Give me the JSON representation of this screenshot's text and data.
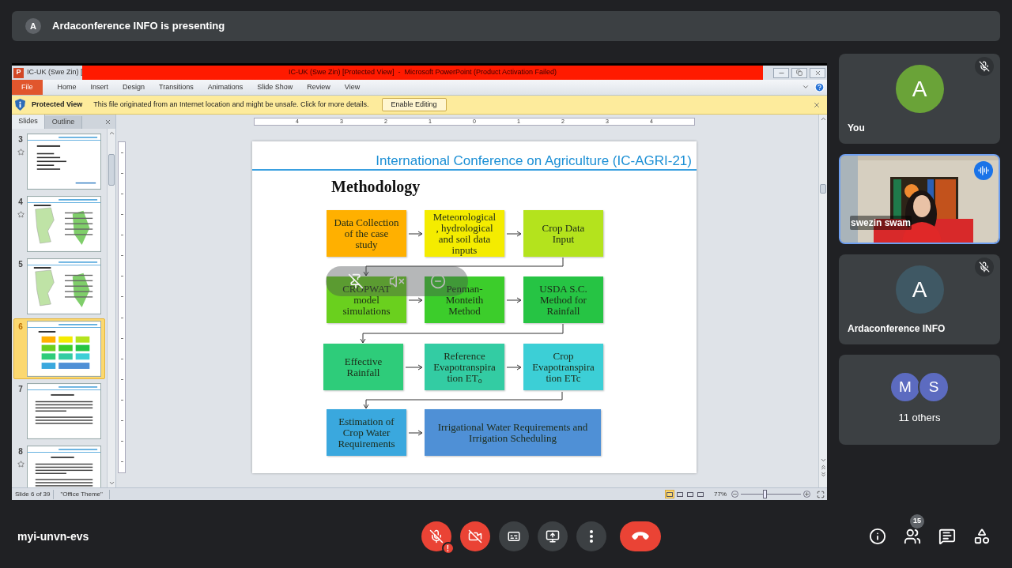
{
  "banner": {
    "avatar": "A",
    "text": "Ardaconference INFO is presenting"
  },
  "powerpoint": {
    "app_icon": "P",
    "title_stub": "IC-UK (Swe Zin) [",
    "title": "IC-UK (Swe Zin) [Protected View]  -  Microsoft PowerPoint (Product Activation Failed)",
    "ribbon_tabs": [
      {
        "label": "File",
        "selected": true
      },
      {
        "label": "Home",
        "selected": false
      },
      {
        "label": "Insert",
        "selected": false
      },
      {
        "label": "Design",
        "selected": false
      },
      {
        "label": "Transitions",
        "selected": false
      },
      {
        "label": "Animations",
        "selected": false
      },
      {
        "label": "Slide Show",
        "selected": false
      },
      {
        "label": "Review",
        "selected": false
      },
      {
        "label": "View",
        "selected": false
      }
    ],
    "protected_view": {
      "label": "Protected View",
      "message": "This file originated from an Internet location and might be unsafe. Click for more details.",
      "button": "Enable Editing"
    },
    "panel_tabs": [
      {
        "label": "Slides",
        "selected": true
      },
      {
        "label": "Outline",
        "selected": false
      }
    ],
    "thumbnails": [
      {
        "number": "3",
        "kind": "bullets",
        "starred": true,
        "selected": false
      },
      {
        "number": "4",
        "kind": "map",
        "starred": true,
        "selected": false
      },
      {
        "number": "5",
        "kind": "map",
        "starred": false,
        "selected": false
      },
      {
        "number": "6",
        "kind": "flowchart",
        "starred": false,
        "selected": true
      },
      {
        "number": "7",
        "kind": "text",
        "starred": false,
        "selected": false
      },
      {
        "number": "8",
        "kind": "text",
        "starred": true,
        "selected": false
      }
    ],
    "ruler_labels": [
      "4",
      "3",
      "2",
      "1",
      "0",
      "1",
      "2",
      "3",
      "4"
    ],
    "status": {
      "slide": "Slide 6 of 39",
      "theme": "\"Office Theme\"",
      "views": [
        {
          "selected": true
        },
        {
          "selected": false
        },
        {
          "selected": false
        },
        {
          "selected": false
        }
      ],
      "zoom": "77%",
      "level": 0.4
    }
  },
  "slide": {
    "header": "International Conference on Agriculture (IC-AGRI-21)",
    "heading": "Methodology",
    "rows": [
      [
        {
          "text": "Data Collection of the case study",
          "color": "#ffb000"
        },
        {
          "text": "Meteorological , hydrological and soil data inputs",
          "color": "#f4ec00"
        },
        {
          "text": "Crop Data Input",
          "color": "#b4e31d"
        }
      ],
      [
        {
          "text": "CROPWAT model simulations",
          "color": "#6ad01e"
        },
        {
          "text": "Penman-Monteith Method",
          "color": "#3ccd2b"
        },
        {
          "text": "USDA S.C. Method for Rainfall",
          "color": "#26c444"
        }
      ],
      [
        {
          "text": "Effective Rainfall",
          "color": "#2ecc7a"
        },
        {
          "text": "Reference Evapotranspira tion ET$_{o}$",
          "color": "#33cca3"
        },
        {
          "text": "Crop Evapotranspira tion ETc",
          "color": "#3ccfd6"
        }
      ],
      [
        {
          "text": "Estimation of Crop Water Requirements",
          "color": "#3aa8de"
        },
        {
          "text": "Irrigational  Water Requirements  and Irrigation Scheduling",
          "color": "#4f90d6"
        }
      ]
    ]
  },
  "participants": [
    {
      "kind": "avatar",
      "name": "You",
      "initial": "A",
      "color": "#6aa338",
      "muted": true
    },
    {
      "kind": "video",
      "name": "swezin swam",
      "speaking": true
    },
    {
      "kind": "avatar",
      "name": "Ardaconference INFO",
      "initial": "A",
      "color": "#3f5864",
      "muted": true
    },
    {
      "kind": "others",
      "label": "11 others",
      "avatars": [
        {
          "initial": "M",
          "color": "#5c6bc0"
        },
        {
          "initial": "S",
          "color": "#5c6bc0"
        }
      ]
    }
  ],
  "meeting": {
    "code": "myi-unvn-evs",
    "controls": [
      {
        "kind": "mic",
        "on": false,
        "alert": "!"
      },
      {
        "kind": "camera",
        "on": false
      },
      {
        "kind": "captions"
      },
      {
        "kind": "present"
      },
      {
        "kind": "more"
      },
      {
        "kind": "end"
      }
    ],
    "side": [
      {
        "kind": "info"
      },
      {
        "kind": "people",
        "badge": "15"
      },
      {
        "kind": "chat"
      },
      {
        "kind": "activities"
      }
    ]
  }
}
